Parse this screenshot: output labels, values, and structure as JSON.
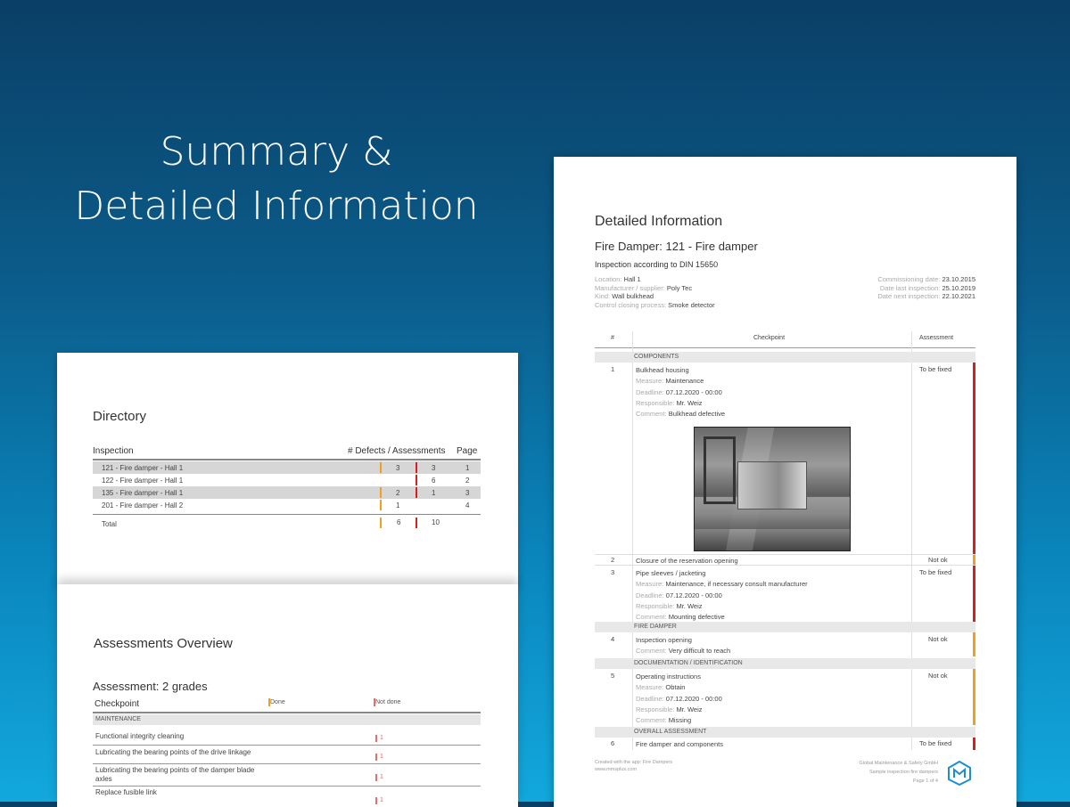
{
  "hero": {
    "line1": "Summary &",
    "line2": "Detailed Information"
  },
  "directory": {
    "title": "Directory",
    "col_inspection": "Inspection",
    "col_defects": "# Defects / Assessments",
    "col_page": "Page",
    "rows": [
      {
        "label": "121 - Fire damper - Hall 1",
        "defects": "3",
        "assessments": "3",
        "page": "1",
        "shaded": true
      },
      {
        "label": "122 - Fire damper - Hall 1",
        "defects": "",
        "assessments": "6",
        "page": "2",
        "shaded": false
      },
      {
        "label": "135 - Fire damper - Hall 1",
        "defects": "2",
        "assessments": "1",
        "page": "3",
        "shaded": true
      },
      {
        "label": "201 - Fire damper - Hall 2",
        "defects": "1",
        "assessments": "",
        "page": "4",
        "shaded": false
      }
    ],
    "total_label": "Total",
    "total_defects": "6",
    "total_assessments": "10"
  },
  "assessments": {
    "title": "Assessments Overview",
    "subtitle": "Assessment: 2 grades",
    "col_checkpoint": "Checkpoint",
    "col_done": "Done",
    "col_not_done": "Not done",
    "section": "MAINTENANCE",
    "rows": [
      {
        "label": "Functional integrity cleaning",
        "value": "1"
      },
      {
        "label": "Lubricating the bearing points of the drive linkage",
        "value": "1"
      },
      {
        "label": "Lubricating the bearing points of the damper blade axles",
        "value": "1"
      },
      {
        "label": "Replace fusible link",
        "value": "1"
      }
    ]
  },
  "detail": {
    "title": "Detailed Information",
    "subtitle": "Fire Damper: 121 - Fire damper",
    "inspection": "Inspection according to DIN 15650",
    "meta_left": [
      {
        "k": "Location:",
        "v": "Hall 1"
      },
      {
        "k": "Manufacturer / supplier:",
        "v": "Poly Tec"
      },
      {
        "k": "Kind:",
        "v": "Wall bulkhead"
      },
      {
        "k": "Control closing process:",
        "v": "Smoke detector"
      }
    ],
    "meta_right": [
      {
        "k": "Commissioning date:",
        "v": "23.10.2015"
      },
      {
        "k": "Date last inspection:",
        "v": "25.10.2019"
      },
      {
        "k": "Date next inspection:",
        "v": "22.10.2021"
      }
    ],
    "col_num": "#",
    "col_checkpoint": "Checkpoint",
    "col_assessment": "Assessment",
    "sections": {
      "components": "COMPONENTS",
      "fire_damper": "FIRE DAMPER",
      "documentation": "DOCUMENTATION / IDENTIFICATION",
      "overall": "OVERALL ASSESSMENT"
    },
    "items": {
      "i1": {
        "num": "1",
        "title": "Bulkhead housing",
        "measure_k": "Measure:",
        "measure_v": "Maintenance",
        "deadline_k": "Deadline:",
        "deadline_v": "07.12.2020 - 00:00",
        "resp_k": "Responsible:",
        "resp_v": "Mr. Weiz",
        "comment_k": "Comment:",
        "comment_v": "Bulkhead defective",
        "assessment": "To be fixed",
        "color": "#d62020"
      },
      "i2": {
        "num": "2",
        "title": "Closure of the reservation opening",
        "assessment": "Not ok",
        "color": "#f0a020"
      },
      "i3": {
        "num": "3",
        "title": "Pipe sleeves / jacketing",
        "measure_k": "Measure:",
        "measure_v": "Maintenance, if necessary consult manufacturer",
        "deadline_k": "Deadline:",
        "deadline_v": "07.12.2020 - 00:00",
        "resp_k": "Responsible:",
        "resp_v": "Mr. Weiz",
        "comment_k": "Comment:",
        "comment_v": "Mounting defective",
        "assessment": "To be fixed",
        "color": "#d62020"
      },
      "i4": {
        "num": "4",
        "title": "Inspection opening",
        "comment_k": "Comment:",
        "comment_v": "Very difficult to reach",
        "assessment": "Not ok",
        "color": "#f0a020"
      },
      "i5": {
        "num": "5",
        "title": "Operating instructions",
        "measure_k": "Measure:",
        "measure_v": "Obtain",
        "deadline_k": "Deadline:",
        "deadline_v": "07.12.2020 - 00:00",
        "resp_k": "Responsible:",
        "resp_v": "Mr. Weiz",
        "comment_k": "Comment:",
        "comment_v": "Missing",
        "assessment": "Not ok",
        "color": "#f0a020"
      },
      "i6": {
        "num": "6",
        "title": "Fire damper and components",
        "assessment": "To be fixed",
        "color": "#d62020"
      }
    },
    "footer_left_1": "Created with the app: Fire Dampers",
    "footer_left_2": "www.mmsplus.com",
    "footer_right_1": "Global Maintenance & Safety GmbH",
    "footer_right_2": "Sample inspection fire dampers",
    "footer_right_3": "Page 1 of 4"
  },
  "colors": {
    "red": "#d62020",
    "orange": "#f0a020",
    "pink": "#e07070"
  }
}
